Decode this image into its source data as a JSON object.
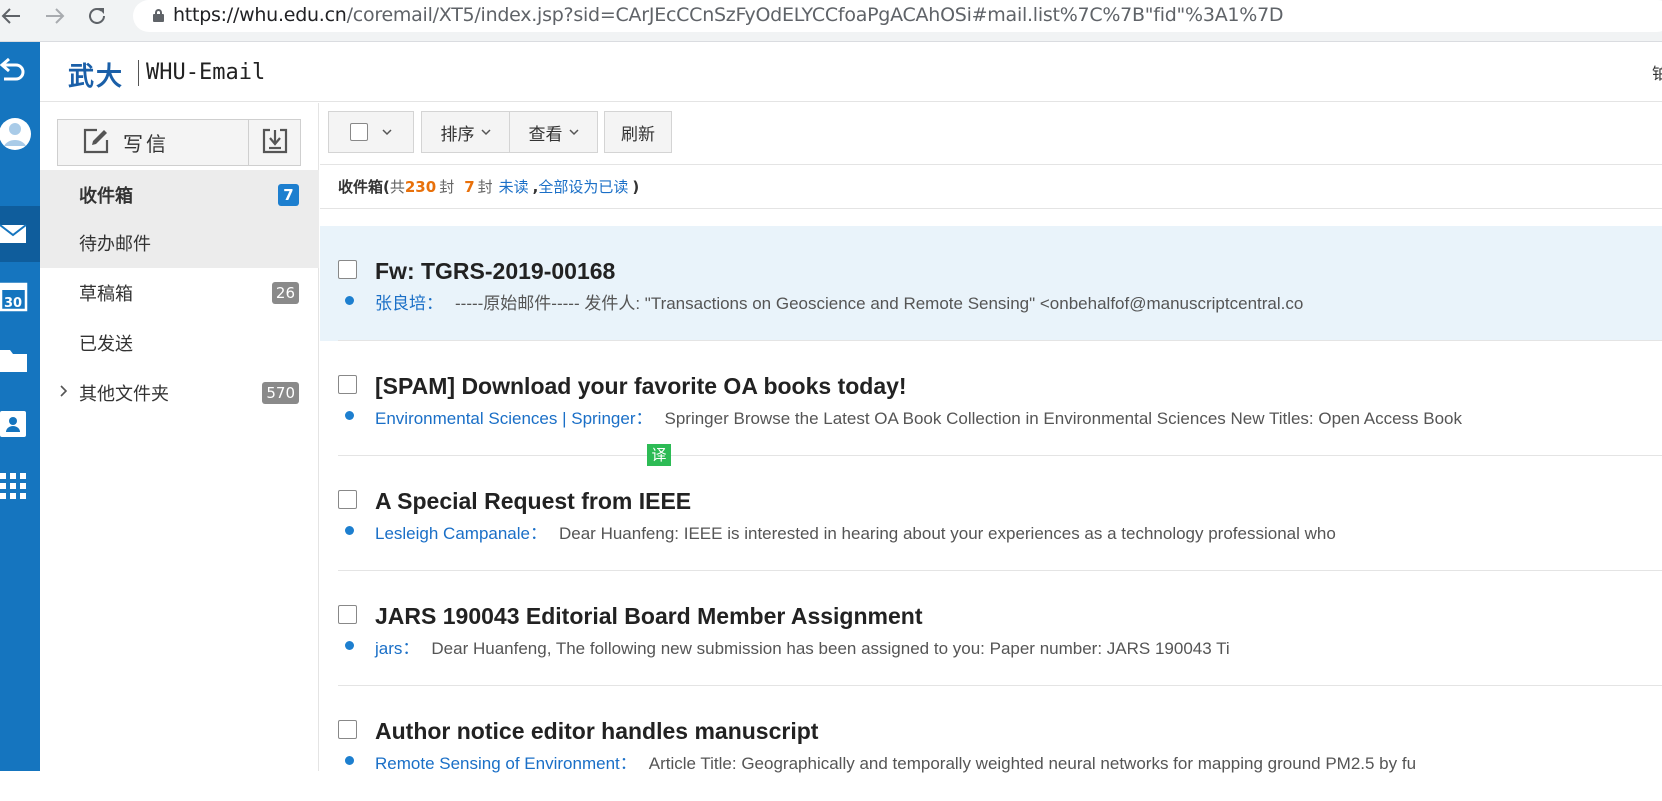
{
  "browser": {
    "url_host": "https://whu.edu.cn",
    "url_path": "/coremail/XT5/index.jsp?sid=CArJEcCCnSzFyOdELYCCfoaPgACAhOSi#mail.list%7C%7B\"fid\"%3A1%7D"
  },
  "header": {
    "logo_cn": "武大",
    "logo_en": "WHU-Email",
    "right_text": "铂"
  },
  "sidebar": {
    "compose_label": "写信",
    "folders": [
      {
        "label": "收件箱",
        "badge": "7"
      },
      {
        "label": "待办邮件",
        "badge": ""
      },
      {
        "label": "草稿箱",
        "badge": "26"
      },
      {
        "label": "已发送",
        "badge": ""
      },
      {
        "label": "其他文件夹",
        "badge": "570"
      }
    ]
  },
  "toolbar": {
    "sort_label": "排序",
    "view_label": "查看",
    "refresh_label": "刷新"
  },
  "status": {
    "folder": "收件箱(",
    "total_prefix": "共",
    "total": "230",
    "unit1": "封",
    "unread": "7",
    "unit2": "封",
    "unread_label": "未读",
    "comma": ",",
    "mark_all": "全部设为已读",
    "close": ")"
  },
  "messages": [
    {
      "subject": "Fw: TGRS-2019-00168",
      "sender": "张良培",
      "sep": "：",
      "preview": "-----原始邮件----- 发件人: \"Transactions on Geoscience and Remote Sensing\" <onbehalfof@manuscriptcentral.co"
    },
    {
      "subject": "[SPAM] Download your favorite OA books today!",
      "sender": "Environmental Sciences | Springer",
      "sep": "：",
      "preview": "Springer Browse the Latest OA Book Collection in Environmental Sciences New Titles: Open Access Book"
    },
    {
      "subject": "A Special Request from IEEE",
      "sender": "Lesleigh Campanale",
      "sep": "：",
      "preview": "Dear Huanfeng: IEEE is interested in hearing about your experiences as a technology professional who"
    },
    {
      "subject": "JARS 190043 Editorial Board Member Assignment",
      "sender": "jars",
      "sep": "：",
      "preview": "Dear Huanfeng, The following new submission has been assigned to you: Paper number: JARS 190043 Ti"
    },
    {
      "subject": "Author notice editor handles manuscript",
      "sender": "Remote Sensing of Environment",
      "sep": "：",
      "preview": "Article Title: Geographically and temporally weighted neural networks for mapping ground PM2.5 by fu"
    }
  ],
  "translate_chip": "译",
  "rail": {
    "calendar_day": "30"
  },
  "colors": {
    "rail": "#1575bf",
    "accent": "#1d7fcf",
    "link": "#1a6fc7",
    "count_highlight": "#e8700a",
    "selected_row": "#e9f3fa",
    "translate": "#2dbb55"
  }
}
